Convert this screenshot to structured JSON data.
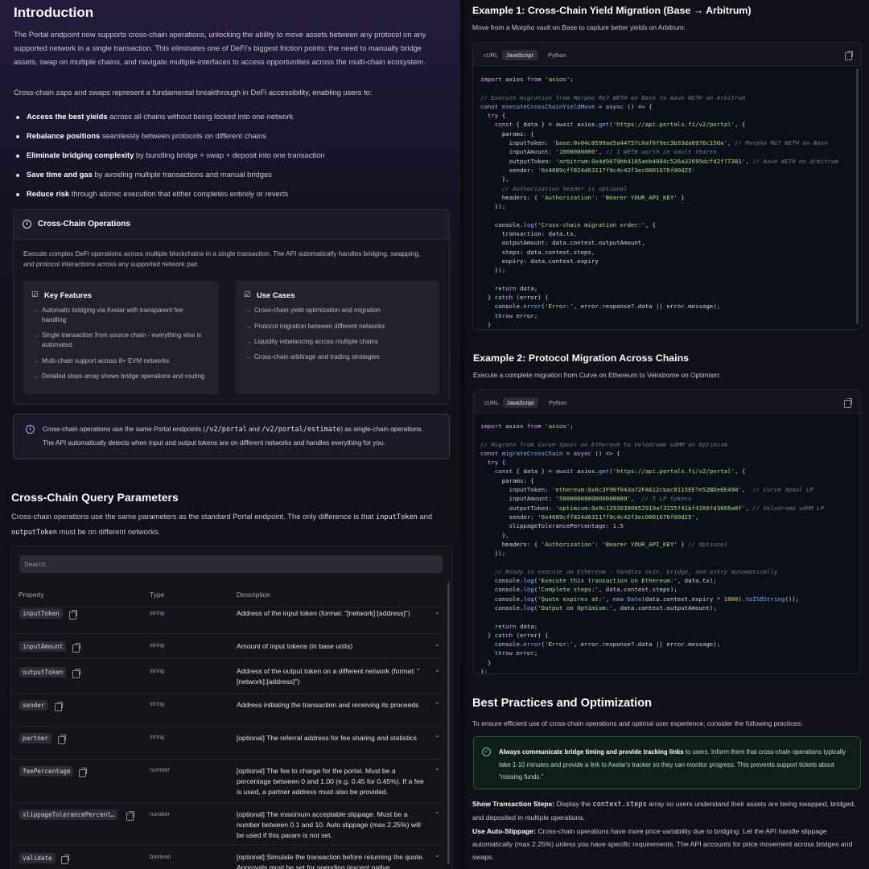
{
  "intro": {
    "title": "Introduction",
    "para1": "The Portal endpoint now supports cross-chain operations, unlocking the ability to move assets between any protocol on any supported network in a single transaction. This eliminates one of DeFi's biggest friction points: the need to manually bridge assets, swap on multiple chains, and navigate multiple-interfaces to access opportunities across the multi-chain ecosystem.",
    "para2": "Cross-chain zaps and swaps represent a fundamental breakthrough in DeFi accessibility, enabling users to:",
    "bullets": [
      {
        "bold": "Access the best yields",
        "rest": " across all chains without being locked into one network"
      },
      {
        "bold": "Rebalance positions",
        "rest": " seamlessly between protocols on different chains"
      },
      {
        "bold": "Eliminate bridging complexity",
        "rest": " by bundling bridge + swap + deposit into one transaction"
      },
      {
        "bold": "Save time and gas",
        "rest": " by avoiding multiple transactions and manual bridges"
      },
      {
        "bold": "Reduce risk",
        "rest": " through atomic execution that either completes entirely or reverts"
      }
    ]
  },
  "ops": {
    "title": "Cross-Chain Operations",
    "body": "Execute complex DeFi operations across multiple blockchains in a single transaction. The API automatically handles bridging, swapping, and protocol interactions across any supported network pair.",
    "features_title": "Key Features",
    "features": [
      "Automatic bridging via Axelar with transparent fee handling",
      "Single transaction from source chain - everything else is automated",
      "Multi-chain support across 8+ EVM networks",
      "Detailed steps array shows bridge operations and routing"
    ],
    "usecases_title": "Use Cases",
    "usecases": [
      "Cross-chain yield optimization and migration",
      "Protocol migration between different networks",
      "Liquidity rebalancing across multiple chains",
      "Cross-chain arbitrage and trading strategies"
    ]
  },
  "note": {
    "pre": "Cross-chain operations use the same Portal endpoints (",
    "code1": "/v2/portal",
    "mid": " and ",
    "code2": "/v2/portal/estimate",
    "post": ") as single-chain operations.",
    "line2": "The API automatically detects when input and output tokens are on different networks and handles everything for you."
  },
  "query": {
    "title": "Cross-Chain Query Parameters",
    "desc_pre": "Cross-chain operations use the same parameters as the standard Portal endpoint. The only difference is that ",
    "code1": "inputToken",
    "desc_mid": " and ",
    "code2": "outputToken",
    "desc_post": " must be on different networks.",
    "search_placeholder": "Search...",
    "headers": {
      "property": "Property",
      "type": "Type",
      "description": "Description"
    },
    "rows": [
      {
        "prop": "inputToken",
        "type": "string",
        "desc": "Address of the input token (format: \"[network]:[address]\")"
      },
      {
        "prop": "inputAmount",
        "type": "string",
        "desc": "Amount of input tokens (in base units)"
      },
      {
        "prop": "outputToken",
        "type": "string",
        "desc": "Address of the output token on a different network (format: \"[network]:[address]\")"
      },
      {
        "prop": "sender",
        "type": "string",
        "desc": "Address initiating the transaction and receiving its proceeds"
      },
      {
        "prop": "partner",
        "type": "string",
        "desc": "[optional] The referral address for fee sharing and statistics"
      },
      {
        "prop": "feePercentage",
        "type": "number",
        "desc": "[optional] The fee to charge for the portal. Must be a percentage between 0 and 1.00 (e.g. 0.45 for 0.45%). If a fee is used, a partner address must also be provided."
      },
      {
        "prop": "slippageTolerancePercent…",
        "type": "number",
        "desc": "[optional] The maximum acceptable slippage. Must be a number between 0.1 and 10. Auto slippage (max 2.25%) will be used if this param is not set."
      },
      {
        "prop": "validate",
        "type": "boolean",
        "desc": "[optional] Simulate the transaction before returning the quote. Approvals must be set for spending (except native"
      }
    ]
  },
  "ex1": {
    "title": "Example 1: Cross-Chain Yield Migration (Base → Arbitrum)",
    "desc": "Move from a Morpho vault on Base to capture better yields on Arbitrum:",
    "tabs": [
      "cURL",
      "JavaScript",
      "Python"
    ]
  },
  "ex2": {
    "title": "Example 2: Protocol Migration Across Chains",
    "desc": "Execute a complete migration from Curve on Ethereum to Velodrome on Optimism:",
    "tabs": [
      "cURL",
      "JavaScript",
      "Python"
    ]
  },
  "best": {
    "title": "Best Practices and Optimization",
    "desc": "To ensure efficient use of cross-chain operations and optimal user experience, consider the following practices:",
    "tip_bold": "Always communicate bridge timing and provide tracking links",
    "tip_rest": " to users. Inform them that cross-chain operations typically take 1-10 minutes and provide a link to Axelar's tracker so they can monitor progress. This prevents support tickets about \"missing funds.\"",
    "p1_bold": "Show Transaction Steps:",
    "p1_pre": " Display the ",
    "p1_code": "context.steps",
    "p1_post": " array so users understand their assets are being swapped, bridged, and deposited in multiple operations.",
    "p2_bold": "Use Auto-Slippage:",
    "p2_rest": " Cross-chain operations have more price variability due to bridging. Let the API handle slippage automatically (max 2.25%) unless you have specific requirements. The API accounts for price movement across bridges and swaps."
  }
}
